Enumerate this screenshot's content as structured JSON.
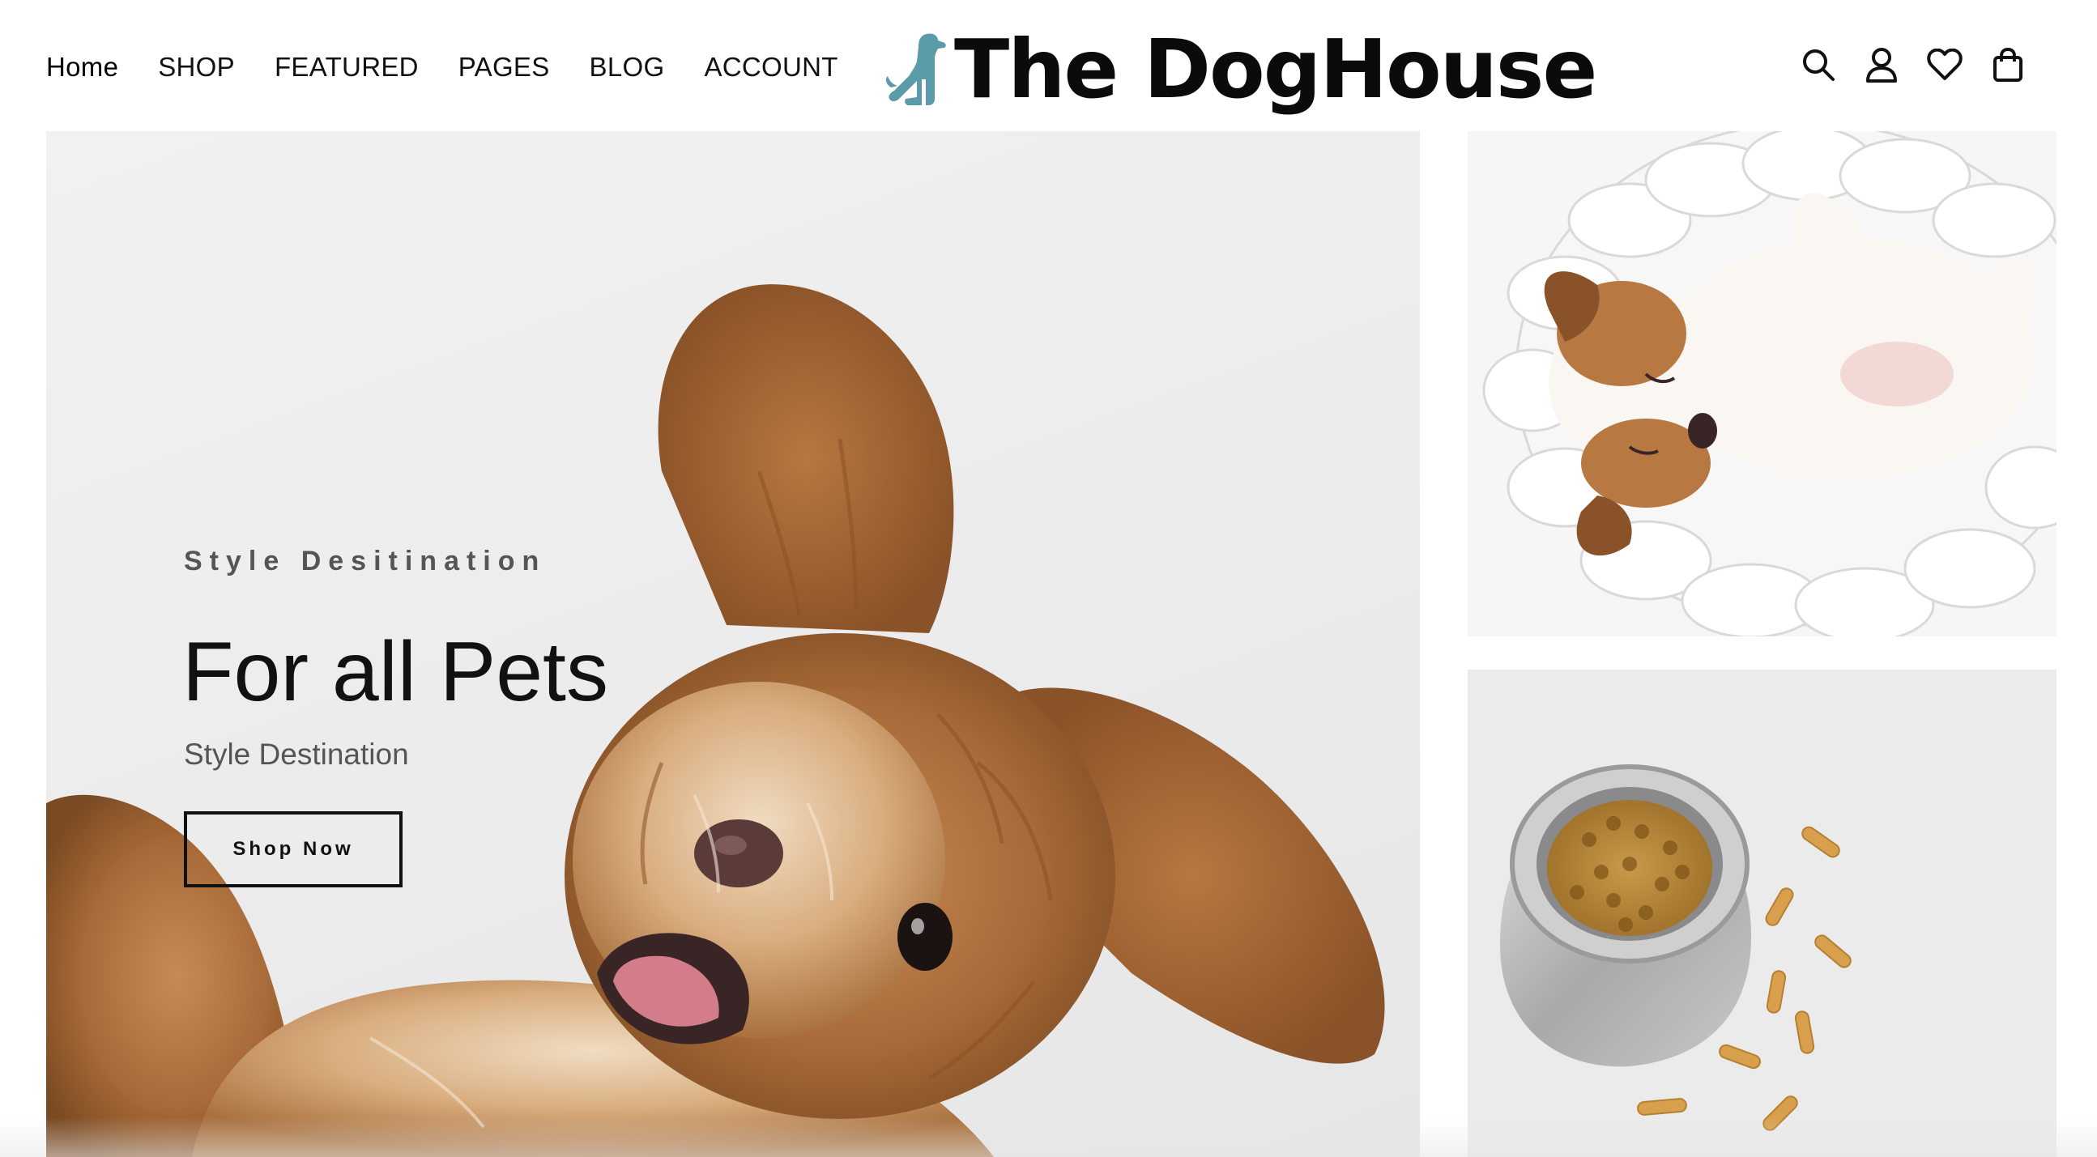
{
  "nav": {
    "items": [
      {
        "label": "Home",
        "key": "home"
      },
      {
        "label": "SHOP",
        "key": "shop"
      },
      {
        "label": "FEATURED",
        "key": "featured"
      },
      {
        "label": "PAGES",
        "key": "pages"
      },
      {
        "label": "BLOG",
        "key": "blog"
      },
      {
        "label": "ACCOUNT",
        "key": "account"
      }
    ]
  },
  "brand": {
    "name": "The DogHouse",
    "logo_icon": "dog-silhouette-icon",
    "logo_color": "#5b9aa8"
  },
  "header_icons": [
    "search-icon",
    "user-icon",
    "heart-icon",
    "shopping-bag-icon"
  ],
  "hero": {
    "eyebrow": "Style Desitination",
    "title": "For all Pets",
    "subtitle": "Style Destination",
    "cta_label": "Shop Now",
    "image": "fluffy-brown-puppy-image"
  },
  "tiles": [
    {
      "image": "puppy-sleeping-in-knitted-bed-image"
    },
    {
      "image": "dog-food-bowl-with-bone-treats-image"
    }
  ]
}
